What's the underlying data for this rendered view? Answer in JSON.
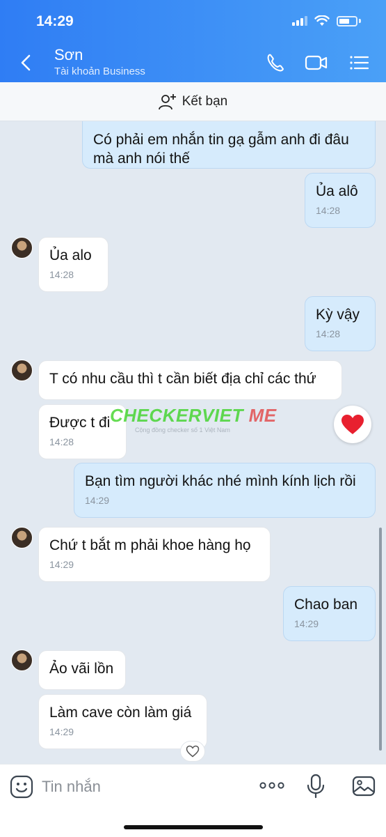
{
  "status_bar": {
    "time": "14:29"
  },
  "header": {
    "contact_name": "Sơn",
    "contact_subtitle": "Tài khoản Business",
    "accent_color": "#2f7df4"
  },
  "friend_bar": {
    "label": "Kết bạn"
  },
  "messages": [
    {
      "direction": "out",
      "text": "Có phải em nhắn tin gạ gẫm anh đi đâu mà anh nói thế",
      "time": ""
    },
    {
      "direction": "out",
      "text": "Ủa alô",
      "time": "14:28"
    },
    {
      "direction": "in",
      "text": "Ủa alo",
      "time": "14:28"
    },
    {
      "direction": "out",
      "text": "Kỳ vậy",
      "time": "14:28"
    },
    {
      "direction": "in",
      "text": "T có nhu cầu thì t cần biết địa chỉ các thứ",
      "time": ""
    },
    {
      "direction": "in",
      "text": "Được t đi",
      "time": "14:28"
    },
    {
      "direction": "out",
      "text": "Bạn tìm người khác nhé mình kính lịch rồi",
      "time": "14:29"
    },
    {
      "direction": "in",
      "text": "Chứ t bắt m phải khoe hàng họ",
      "time": "14:29"
    },
    {
      "direction": "out",
      "text": "Chao ban",
      "time": "14:29"
    },
    {
      "direction": "in",
      "text": "Ảo vãi lồn",
      "time": ""
    },
    {
      "direction": "in",
      "text": "Làm cave còn làm giá",
      "time": "14:29"
    }
  ],
  "watermark": {
    "title_main": "CHECKERVIET",
    "title_accent": " ME",
    "subtitle": "Cộng đồng checker số 1 Việt Nam"
  },
  "input_bar": {
    "placeholder": "Tin nhắn"
  },
  "icons": {
    "back": "chevron-left-icon",
    "call": "phone-icon",
    "video": "video-icon",
    "menu": "list-icon",
    "add_friend": "add-user-icon",
    "reaction": "heart-icon",
    "emoji": "emoji-icon",
    "more": "more-dots-icon",
    "mic": "microphone-icon",
    "image": "image-icon"
  }
}
